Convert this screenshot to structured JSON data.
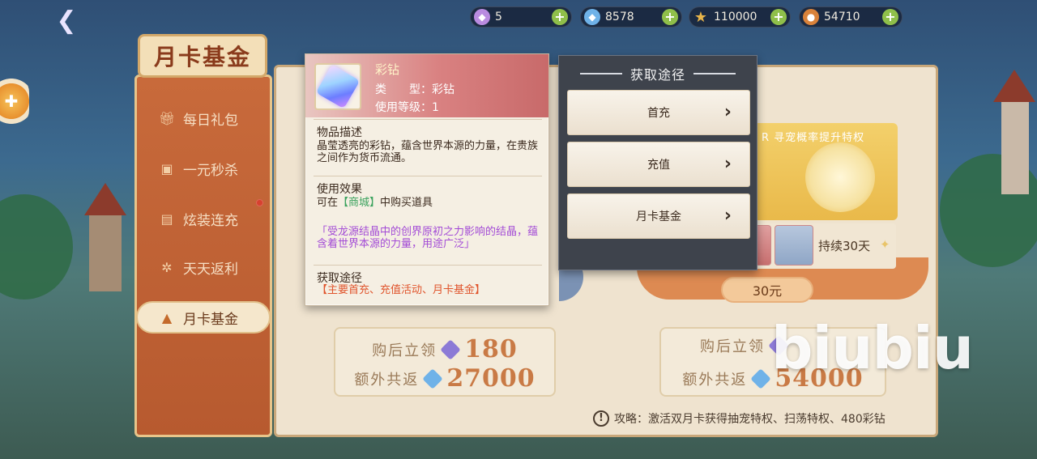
{
  "top_bar": {
    "resources": [
      {
        "icon": "purple-gem-icon",
        "value": "5",
        "color": "#b98be0"
      },
      {
        "icon": "diamond-icon",
        "value": "8578",
        "color": "#6fb2e8"
      },
      {
        "icon": "star-icon",
        "value": "110000",
        "color": "#e8b44a"
      },
      {
        "icon": "coin-icon",
        "value": "54710",
        "color": "#d9823a"
      }
    ],
    "plus_label": "+"
  },
  "sidebar": {
    "title": "月卡基金",
    "items": [
      {
        "label": "每日礼包",
        "icon": "gift-icon"
      },
      {
        "label": "一元秒杀",
        "icon": "ticket-icon"
      },
      {
        "label": "炫装连充",
        "icon": "outfit-icon"
      },
      {
        "label": "天天返利",
        "icon": "wheel-icon"
      },
      {
        "label": "月卡基金",
        "icon": "fund-icon",
        "active": true
      }
    ]
  },
  "main": {
    "left_card": {
      "line1_label": "购后立领",
      "line1_value": "180",
      "line2_label": "额外共返",
      "line2_value": "27000"
    },
    "right_card": {
      "label": "R 寻宠概率提升特权",
      "duration": "持续30天",
      "price": "30元",
      "line1_label": "购后立领",
      "line2_label": "额外共返",
      "line2_value": "54000"
    },
    "tip": "攻略：激活双月卡获得抽宠特权、扫荡特权、480彩钻"
  },
  "item_popup": {
    "name": "彩钻",
    "type_label": "类　　型：彩钻",
    "level_label": "使用等级：1",
    "desc_title": "物品描述",
    "desc_text": "晶莹透亮的彩钻，蕴含世界本源的力量，在贵族之间作为货币流通。",
    "effect_title": "使用效果",
    "effect_prefix": "可在",
    "effect_link": "【商城】",
    "effect_suffix": "中购买道具",
    "quote_text": "「受龙源结晶中的创界原初之力影响的结晶，蕴含着世界本源的力量，用途广泛」",
    "source_title": "获取途径",
    "source_text": "【主要首充、充值活动、月卡基金】"
  },
  "acquire_panel": {
    "title": "获取途径",
    "buttons": [
      "首充",
      "充值",
      "月卡基金"
    ]
  },
  "watermark": "biubiu"
}
